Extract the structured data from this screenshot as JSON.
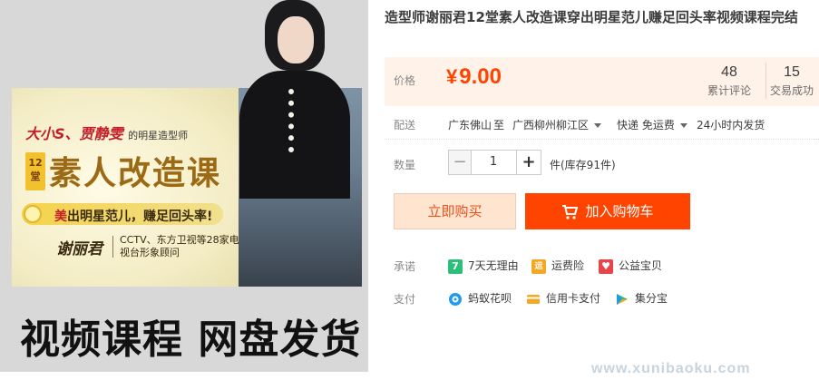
{
  "product": {
    "title": "造型师谢丽君12堂素人改造课穿出明星范儿赚足回头率视频课程完结"
  },
  "banner": {
    "line1_main": "大小S、贾静雯",
    "line1_small": "的明星造型师",
    "badge_top": "12",
    "badge_bottom": "堂",
    "headline": "素人改造课",
    "pill_highlight": "美",
    "pill_text": "出明星范儿，赚足回头率!",
    "name": "谢丽君",
    "credentials": "CCTV、东方卫视等28家电视台形象顾问"
  },
  "caption": "视频课程 网盘发货",
  "price": {
    "label": "价格",
    "currency": "¥",
    "value": "9.00"
  },
  "stats": {
    "reviews_count": "48",
    "reviews_label": "累计评论",
    "trades_count": "15",
    "trades_label": "交易成功"
  },
  "shipping": {
    "label": "配送",
    "from": "广东佛山",
    "to_word": "至",
    "to": "广西柳州柳江区",
    "method": "快递 免运费",
    "eta": "24小时内发货"
  },
  "quantity": {
    "label": "数量",
    "minus": "−",
    "value": "1",
    "plus": "+",
    "stock": "件(库存91件)"
  },
  "buttons": {
    "buy_now": "立即购买",
    "add_to_cart": "加入购物车"
  },
  "promise": {
    "label": "承诺",
    "items": [
      {
        "icon": "seven-day-icon",
        "glyph": "7",
        "color": "#2bbf7a",
        "text": "7天无理由"
      },
      {
        "icon": "shipping-insurance-icon",
        "glyph": "运",
        "color": "#f5a623",
        "text": "运费险"
      },
      {
        "icon": "charity-icon",
        "glyph": "♥",
        "color": "#e8454a",
        "text": "公益宝贝"
      }
    ]
  },
  "payment": {
    "label": "支付",
    "items": [
      {
        "icon": "ant-credit-icon",
        "text": "蚂蚁花呗"
      },
      {
        "icon": "credit-card-icon",
        "text": "信用卡支付"
      },
      {
        "icon": "jifenbao-icon",
        "text": "集分宝"
      }
    ]
  },
  "watermark": "www.xunibaoku.com",
  "colors": {
    "accent": "#ff4400",
    "price": "#ff4400",
    "price_bg": "#fff2e8"
  }
}
